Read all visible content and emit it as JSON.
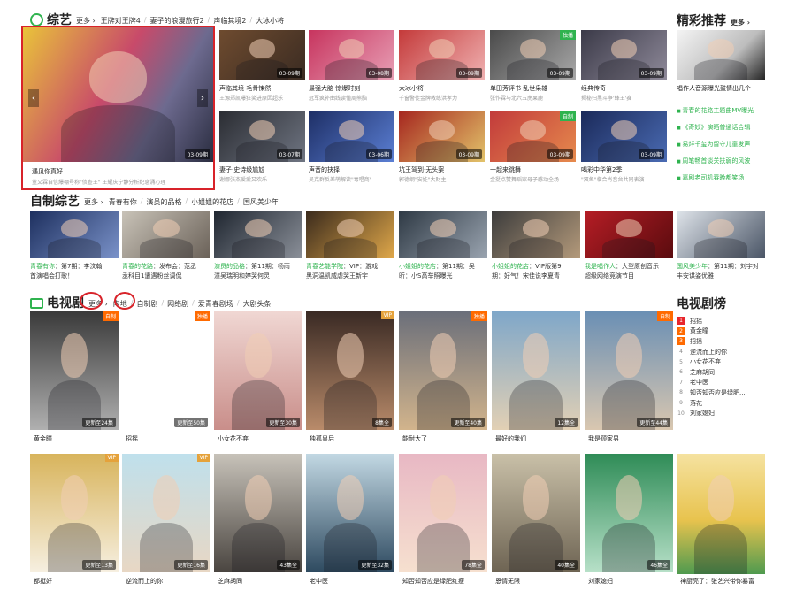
{
  "variety": {
    "title": "综艺",
    "more": "更多",
    "tags": [
      "王牌对王牌4",
      "妻子的浪漫旅行2",
      "声临其境2",
      "大冰小将"
    ],
    "feature": {
      "title": "遇见你真好",
      "sub": "董又霖自信爆棚号称\"侦查王\" 王耀庆宁静分析纪息涌心理",
      "dur": "03-09期"
    },
    "cards": [
      {
        "title": "声临其境·毛骨悚然",
        "sub": "王源郑凯曝狂笑进原因超乐",
        "dur": "03-09期",
        "c1": "#6e4b2f",
        "c2": "#3a2b22"
      },
      {
        "title": "最强大脑·惊爆时刻",
        "sub": "冠军疯补曲线读懂周熊脑",
        "dur": "03-08期",
        "c1": "#c7345e",
        "c2": "#e8a0b6"
      },
      {
        "title": "大冰小将",
        "sub": "千窗警徒金牌教练洪孝力",
        "dur": "03-09期",
        "c1": "#c43a3a",
        "c2": "#f0b2b2"
      },
      {
        "title": "单田芳评书·乱世枭雄",
        "sub": "张作霖与北六五虎果鹿",
        "dur": "03-09期",
        "c1": "#4a4a4a",
        "c2": "#a9a9a9",
        "badge": "独播"
      },
      {
        "title": "经典传奇",
        "sub": "揭秘扫黑斗争'蜂王'赛",
        "dur": "03-09期",
        "c1": "#3b3a48",
        "c2": "#8f8a9a"
      },
      {
        "title": "妻子·史诗级尴尬",
        "sub": "谢娜张杰爱爱又欢乐",
        "dur": "03-07期",
        "c1": "#2b2d33",
        "c2": "#6f7582"
      },
      {
        "title": "声音的抉择",
        "sub": "吴克群反差萌解读\"毒唱商\"",
        "dur": "03-06期",
        "c1": "#1e2f66",
        "c2": "#5b7fd4"
      },
      {
        "title": "坑王驾到·无头案",
        "sub": "郭德纲\"安娃\"大财主",
        "dur": "03-09期",
        "c1": "#a6271f",
        "c2": "#e2c36a"
      },
      {
        "title": "一起来跳舞",
        "sub": "金挺点赞舞蹈家母子感动全场",
        "dur": "03-09期",
        "c1": "#c23b3b",
        "c2": "#e68a4d",
        "badge": "自制"
      },
      {
        "title": "喝彩中华第2季",
        "sub": "\"双鱼\"临合肖音台共同表演",
        "dur": "03-09期",
        "c1": "#1b2a5a",
        "c2": "#4a6bb3"
      }
    ]
  },
  "recommend": {
    "title": "精彩推荐",
    "more": "更多",
    "feature_title": "唱作人音源曝光鼓情出几个",
    "items": [
      "青春的花路主题曲MV曝光",
      "《奇妙》演晒普通话合辑",
      "易烊千玺为留守儿童发声",
      "周笔畅首谈关扶弱的风波",
      "嘉剧老司机春晚都笑场"
    ]
  },
  "selfmade": {
    "title": "自制综艺",
    "more": "更多",
    "tags": [
      "青春有你",
      "演员的品格",
      "小姐姐的花店",
      "国风美少年"
    ],
    "cards": [
      {
        "show": "青春有你",
        "rest": "：第7期：李汶翰",
        "line2": "首演唱会打歌！",
        "c1": "#1d2f5e",
        "c2": "#7a92c9"
      },
      {
        "show": "青春的花路",
        "rest": "：发布会：范丞",
        "line2": "丞科目1遭遇粉丝调侃",
        "c1": "#c9c3b8",
        "c2": "#6a6158"
      },
      {
        "show": "演员的品格",
        "rest": "：第11期：杨雨",
        "line2": "潼吴瑞明和婷哭何灵",
        "c1": "#1f2630",
        "c2": "#8b9099"
      },
      {
        "show": "青春艺能学院",
        "rest": "：VIP：游戏",
        "line2": "黑洞温凯威虐哭王新宇",
        "c1": "#3a2a1c",
        "c2": "#e0a84a"
      },
      {
        "show": "小姐姐的花店",
        "rest": "：第11期：吴",
        "line2": "昕：小S高举照曝光",
        "c1": "#2e3944",
        "c2": "#9aa4b0"
      },
      {
        "show": "小姐姐的花店",
        "rest": "：VIP版第9",
        "line2": "期：好气！宋佳说李夏青",
        "c1": "#3c3c3c",
        "c2": "#b49a7b"
      },
      {
        "show": "我是唱作人",
        "rest": "：大型原创音乐",
        "line2": "超级网络竞演节目",
        "c1": "#b51d25",
        "c2": "#5a0b0e"
      },
      {
        "show": "国风美少年",
        "rest": "：第11期：刘宇对",
        "line2": "丰安谋姿优雅",
        "c1": "#dfe4ea",
        "c2": "#4a5566"
      }
    ]
  },
  "tv": {
    "title": "电视剧",
    "more": "更多",
    "tags": [
      "内地",
      "自制剧",
      "网络剧",
      "爱青春剧场",
      "大剧头条"
    ],
    "row1": [
      {
        "title": "黄金瞳",
        "dur": "更新至24集",
        "badge": "自制",
        "badgeType": "orange",
        "c1": "#3a3a3a",
        "c2": "#b0b0b0"
      },
      {
        "title": "招摇",
        "dur": "更新至50集",
        "badge": "独播",
        "badgeType": "orange",
        "c1": "#ffffff",
        "c2": "#ffffff"
      },
      {
        "title": "小女花不弃",
        "dur": "更新至30集",
        "badge": "",
        "badgeType": "",
        "c1": "#f0d7d3",
        "c2": "#c98e8a"
      },
      {
        "title": "独孤皇后",
        "dur": "8集全",
        "badge": "VIP",
        "badgeType": "vip",
        "c1": "#3a2a24",
        "c2": "#b98b6a"
      },
      {
        "title": "能耐大了",
        "dur": "更新至40集",
        "badge": "独播",
        "badgeType": "orange",
        "c1": "#6b6f7a",
        "c2": "#d2b48c"
      },
      {
        "title": "最好的我们",
        "dur": "12集全",
        "badge": "",
        "badgeType": "",
        "c1": "#7fa7c9",
        "c2": "#e2d0b4"
      },
      {
        "title": "我是顾家男",
        "dur": "更新至44集",
        "badge": "自制",
        "badgeType": "orange",
        "c1": "#6a8fb4",
        "c2": "#d9c7b0"
      }
    ],
    "row2": [
      {
        "title": "都挺好",
        "dur": "更新至13集",
        "badge": "VIP",
        "badgeType": "vip",
        "c1": "#d8b45c",
        "c2": "#f6efe0"
      },
      {
        "title": "逆流而上的你",
        "dur": "更新至16集",
        "badge": "VIP",
        "badgeType": "vip",
        "c1": "#bfe0ec",
        "c2": "#e8d7c4"
      },
      {
        "title": "芝麻胡同",
        "dur": "43集全",
        "badge": "",
        "badgeType": "",
        "c1": "#c7c2b9",
        "c2": "#4a4540"
      },
      {
        "title": "老中医",
        "dur": "更新至32集",
        "badge": "",
        "badgeType": "",
        "c1": "#c2d8e3",
        "c2": "#2e4a60"
      },
      {
        "title": "知否知否应是绿肥红瘦",
        "dur": "78集全",
        "badge": "",
        "badgeType": "",
        "c1": "#e8b8c4",
        "c2": "#f6e0cf"
      },
      {
        "title": "恩情无限",
        "dur": "40集全",
        "badge": "",
        "badgeType": "",
        "c1": "#c9c0a8",
        "c2": "#6e6453"
      },
      {
        "title": "刘家媳妇",
        "dur": "46集全",
        "badge": "",
        "badgeType": "",
        "c1": "#2f8c57",
        "c2": "#b7e0c8"
      },
      {
        "title": "神厨亮了：张艺兴带你暴富",
        "dur": "",
        "badge": "",
        "badgeType": "",
        "c1": "#f2d57a",
        "c2": "#6fa86a"
      }
    ]
  },
  "tvrank": {
    "title": "电视剧榜",
    "items": [
      "招摇",
      "黄金瞳",
      "招摇",
      "逆流而上的你",
      "小女花不弃",
      "芝麻胡同",
      "老中医",
      "知否知否应是绿肥...",
      "落花",
      "刘家媳妇"
    ]
  },
  "icons": {
    "logo": "iqiyi-logo-icon",
    "tv": "tv-icon",
    "arrow_left": "‹",
    "arrow_right": "›"
  }
}
